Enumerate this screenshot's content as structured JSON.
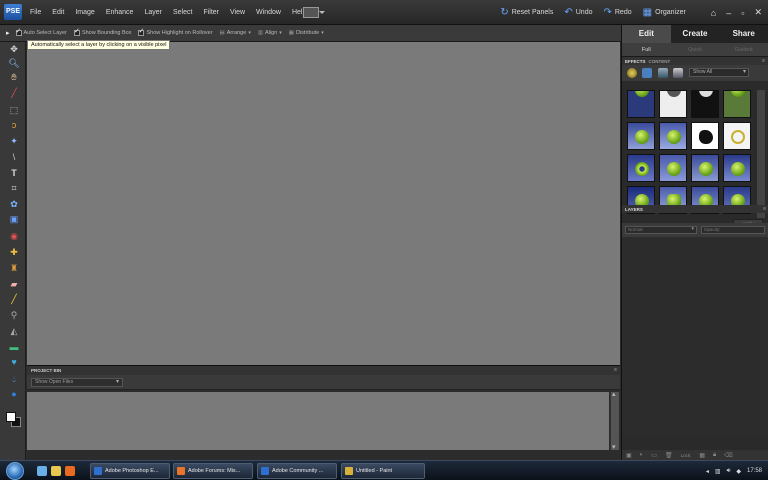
{
  "app": {
    "logo": "PSE",
    "menus": [
      "File",
      "Edit",
      "Image",
      "Enhance",
      "Layer",
      "Select",
      "Filter",
      "View",
      "Window",
      "Help"
    ],
    "right_menus": [
      {
        "icon": "↻",
        "label": "Reset Panels"
      },
      {
        "icon": "↶",
        "label": "Undo"
      },
      {
        "icon": "↷",
        "label": "Redo"
      },
      {
        "icon": "▦",
        "label": "Organizer"
      }
    ],
    "window_controls": [
      "⌂",
      "–",
      "▫",
      "✕"
    ]
  },
  "options": {
    "auto_select": "Auto Select Layer",
    "bounding_box": "Show Bounding Box",
    "highlight": "Show Highlight on Rollover",
    "arrange": "Arrange",
    "align": "Align",
    "distribute": "Distribute",
    "tooltip": "Automatically select a layer by clicking on a visible pixel"
  },
  "panel": {
    "tabs": [
      "Edit",
      "Create",
      "Share"
    ],
    "sub_tabs": [
      "Full",
      "Quick",
      "Guided"
    ],
    "effects_tabs": [
      "EFFECTS",
      "CONTENT"
    ],
    "effects_filter": "Show All",
    "apply": "Apply",
    "layers_title": "LAYERS",
    "blend_mode": "Normal",
    "opacity": "Opacity:",
    "lock_label": "Lock:"
  },
  "project_bin": {
    "title": "PROJECT BIN",
    "select": "Show Open Files"
  },
  "taskbar": {
    "tasks": [
      {
        "label": "Adobe Photoshop E...",
        "color": "#2f6fd0"
      },
      {
        "label": "Adobe Forums: Mis...",
        "color": "#e8752a"
      },
      {
        "label": "Adobe Community ...",
        "color": "#2f6fd0"
      },
      {
        "label": "Untitled - Paint",
        "color": "#d9b03a"
      }
    ],
    "clock": "17:58"
  }
}
